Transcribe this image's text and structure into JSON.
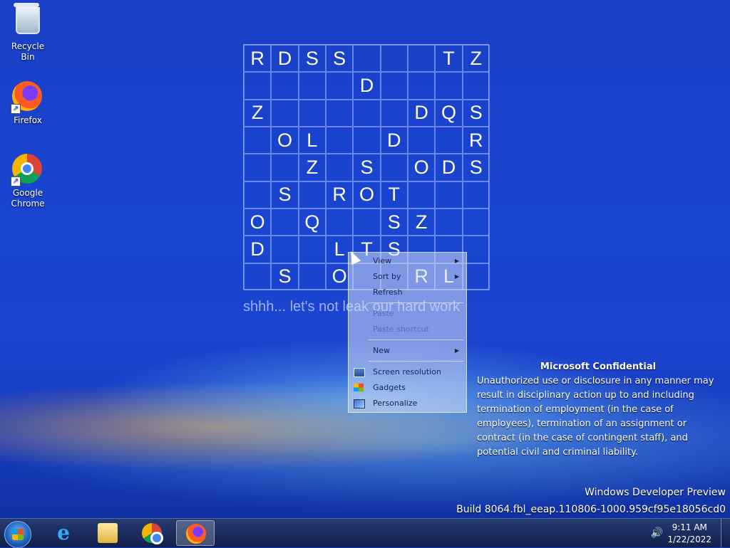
{
  "desktop_icons": [
    {
      "label": "Recycle Bin"
    },
    {
      "label": "Firefox"
    },
    {
      "label": "Google Chrome"
    }
  ],
  "grid": [
    [
      "R",
      "D",
      "S",
      "S",
      "",
      "",
      "",
      "T",
      "Z"
    ],
    [
      "",
      "",
      "",
      "",
      "D",
      "",
      "",
      "",
      ""
    ],
    [
      "Z",
      "",
      "",
      "",
      "",
      "",
      "D",
      "Q",
      "S"
    ],
    [
      "",
      "O",
      "L",
      "",
      "",
      "D",
      "",
      "",
      "R"
    ],
    [
      "",
      "",
      "Z",
      "",
      "S",
      "",
      "O",
      "D",
      "S"
    ],
    [
      "",
      "S",
      "",
      "R",
      "O",
      "T",
      "",
      "",
      ""
    ],
    [
      "O",
      "",
      "Q",
      "",
      "",
      "S",
      "Z",
      "",
      ""
    ],
    [
      "D",
      "",
      "",
      "L",
      "T",
      "S",
      "",
      "",
      ""
    ],
    [
      "",
      "S",
      "",
      "O",
      "",
      "",
      "R",
      "L",
      ""
    ]
  ],
  "tagline": "shhh... let's not leak our hard work",
  "context_menu": {
    "view": "View",
    "sort_by": "Sort by",
    "refresh": "Refresh",
    "paste": "Paste",
    "paste_shortcut": "Paste shortcut",
    "new": "New",
    "screen_resolution": "Screen resolution",
    "gadgets": "Gadgets",
    "personalize": "Personalize"
  },
  "confidential": {
    "title": "Microsoft Confidential",
    "body": "Unauthorized use or disclosure in any manner may result in disciplinary action up to and including termination of employment (in the case of employees), termination of an assignment or contract (in the case of contingent staff), and potential civil and criminal liability."
  },
  "build": {
    "line1": "Windows Developer Preview",
    "line2": "Build 8064.fbl_eeap.110806-1000.959cf95e18056cd0"
  },
  "taskbar": {
    "apps": [
      "start-orb-icon",
      "internet-explorer-icon",
      "file-explorer-icon",
      "chrome-icon",
      "firefox-icon"
    ],
    "active_app": "firefox-icon",
    "time": "9:11 AM",
    "date": "1/22/2022"
  }
}
